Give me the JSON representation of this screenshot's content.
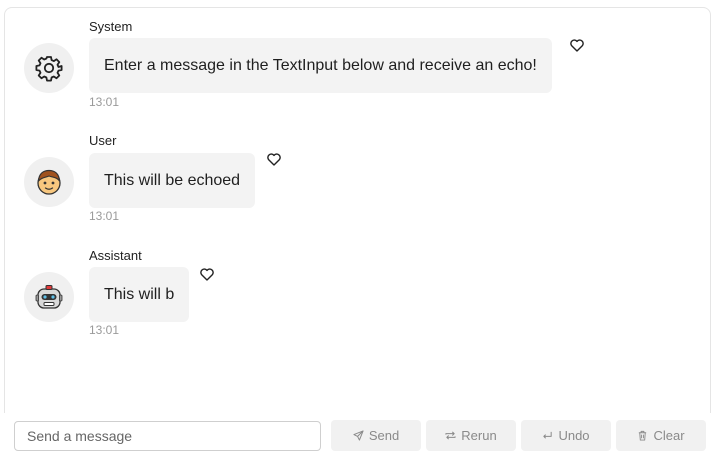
{
  "chat": {
    "messages": [
      {
        "role_label": "System",
        "text": "Enter a message in the TextInput below and receive an echo!",
        "time": "13:01",
        "avatar_icon": "gear-icon"
      },
      {
        "role_label": "User",
        "text": "This will be echoed",
        "time": "13:01",
        "avatar_icon": "user-emoji-icon"
      },
      {
        "role_label": "Assistant",
        "text": "This will b",
        "time": "13:01",
        "avatar_icon": "robot-icon"
      }
    ]
  },
  "composer": {
    "placeholder": "Send a message",
    "value": "",
    "buttons": {
      "send": {
        "label": "Send",
        "icon": "paper-plane-icon"
      },
      "rerun": {
        "label": "Rerun",
        "icon": "repeat-icon"
      },
      "undo": {
        "label": "Undo",
        "icon": "return-arrow-icon"
      },
      "clear": {
        "label": "Clear",
        "icon": "trash-icon"
      }
    }
  }
}
